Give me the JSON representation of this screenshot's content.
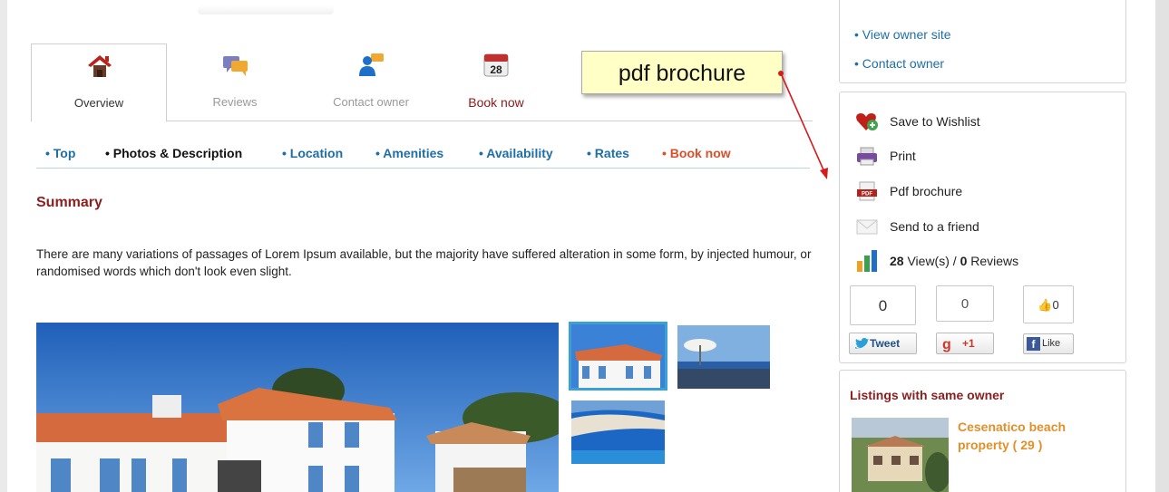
{
  "owner_links": [
    "• View owner site",
    "• Contact owner"
  ],
  "tabs": [
    {
      "label": "Overview",
      "icon": "house-icon"
    },
    {
      "label": "Reviews",
      "icon": "speech-bubbles-icon"
    },
    {
      "label": "Contact owner",
      "icon": "contact-person-icon"
    },
    {
      "label": "Book now",
      "icon": "calendar-icon",
      "calendar_day": "28"
    }
  ],
  "anchor_nav": [
    "• Top",
    "• Photos & Description",
    "• Location",
    "• Amenities",
    "• Availability",
    "• Rates",
    "• Book now"
  ],
  "summary": {
    "title": "Summary",
    "text": "There are many variations of passages of Lorem Ipsum available, but the majority have suffered alteration in some form, by injected humour, or randomised words which don't look even slight."
  },
  "callout": {
    "text": "pdf brochure"
  },
  "actions": [
    {
      "label": "Save to Wishlist",
      "icon": "heart-plus-icon"
    },
    {
      "label": "Print",
      "icon": "printer-icon"
    },
    {
      "label": "Pdf brochure",
      "icon": "pdf-icon"
    },
    {
      "label": "Send to a friend",
      "icon": "envelope-icon"
    }
  ],
  "stats": {
    "views": "28",
    "views_label": " View(s) / ",
    "reviews": "0",
    "reviews_label": " Reviews"
  },
  "social": {
    "twitter": {
      "count": "0",
      "label": "Tweet"
    },
    "gplus": {
      "count": "0",
      "label": "+1"
    },
    "facebook": {
      "count": "0",
      "label": "Like"
    }
  },
  "listings": {
    "title": "Listings with same owner",
    "item_name": "Cesenatico beach property ( 29 )"
  },
  "colors": {
    "link_blue": "#1e6fa8",
    "heading_red": "#8b2020",
    "accent_orange": "#d9502b",
    "listing_orange": "#e0902a",
    "callout_bg": "#ffffc6",
    "thumb_border": "#3aa0d6"
  }
}
